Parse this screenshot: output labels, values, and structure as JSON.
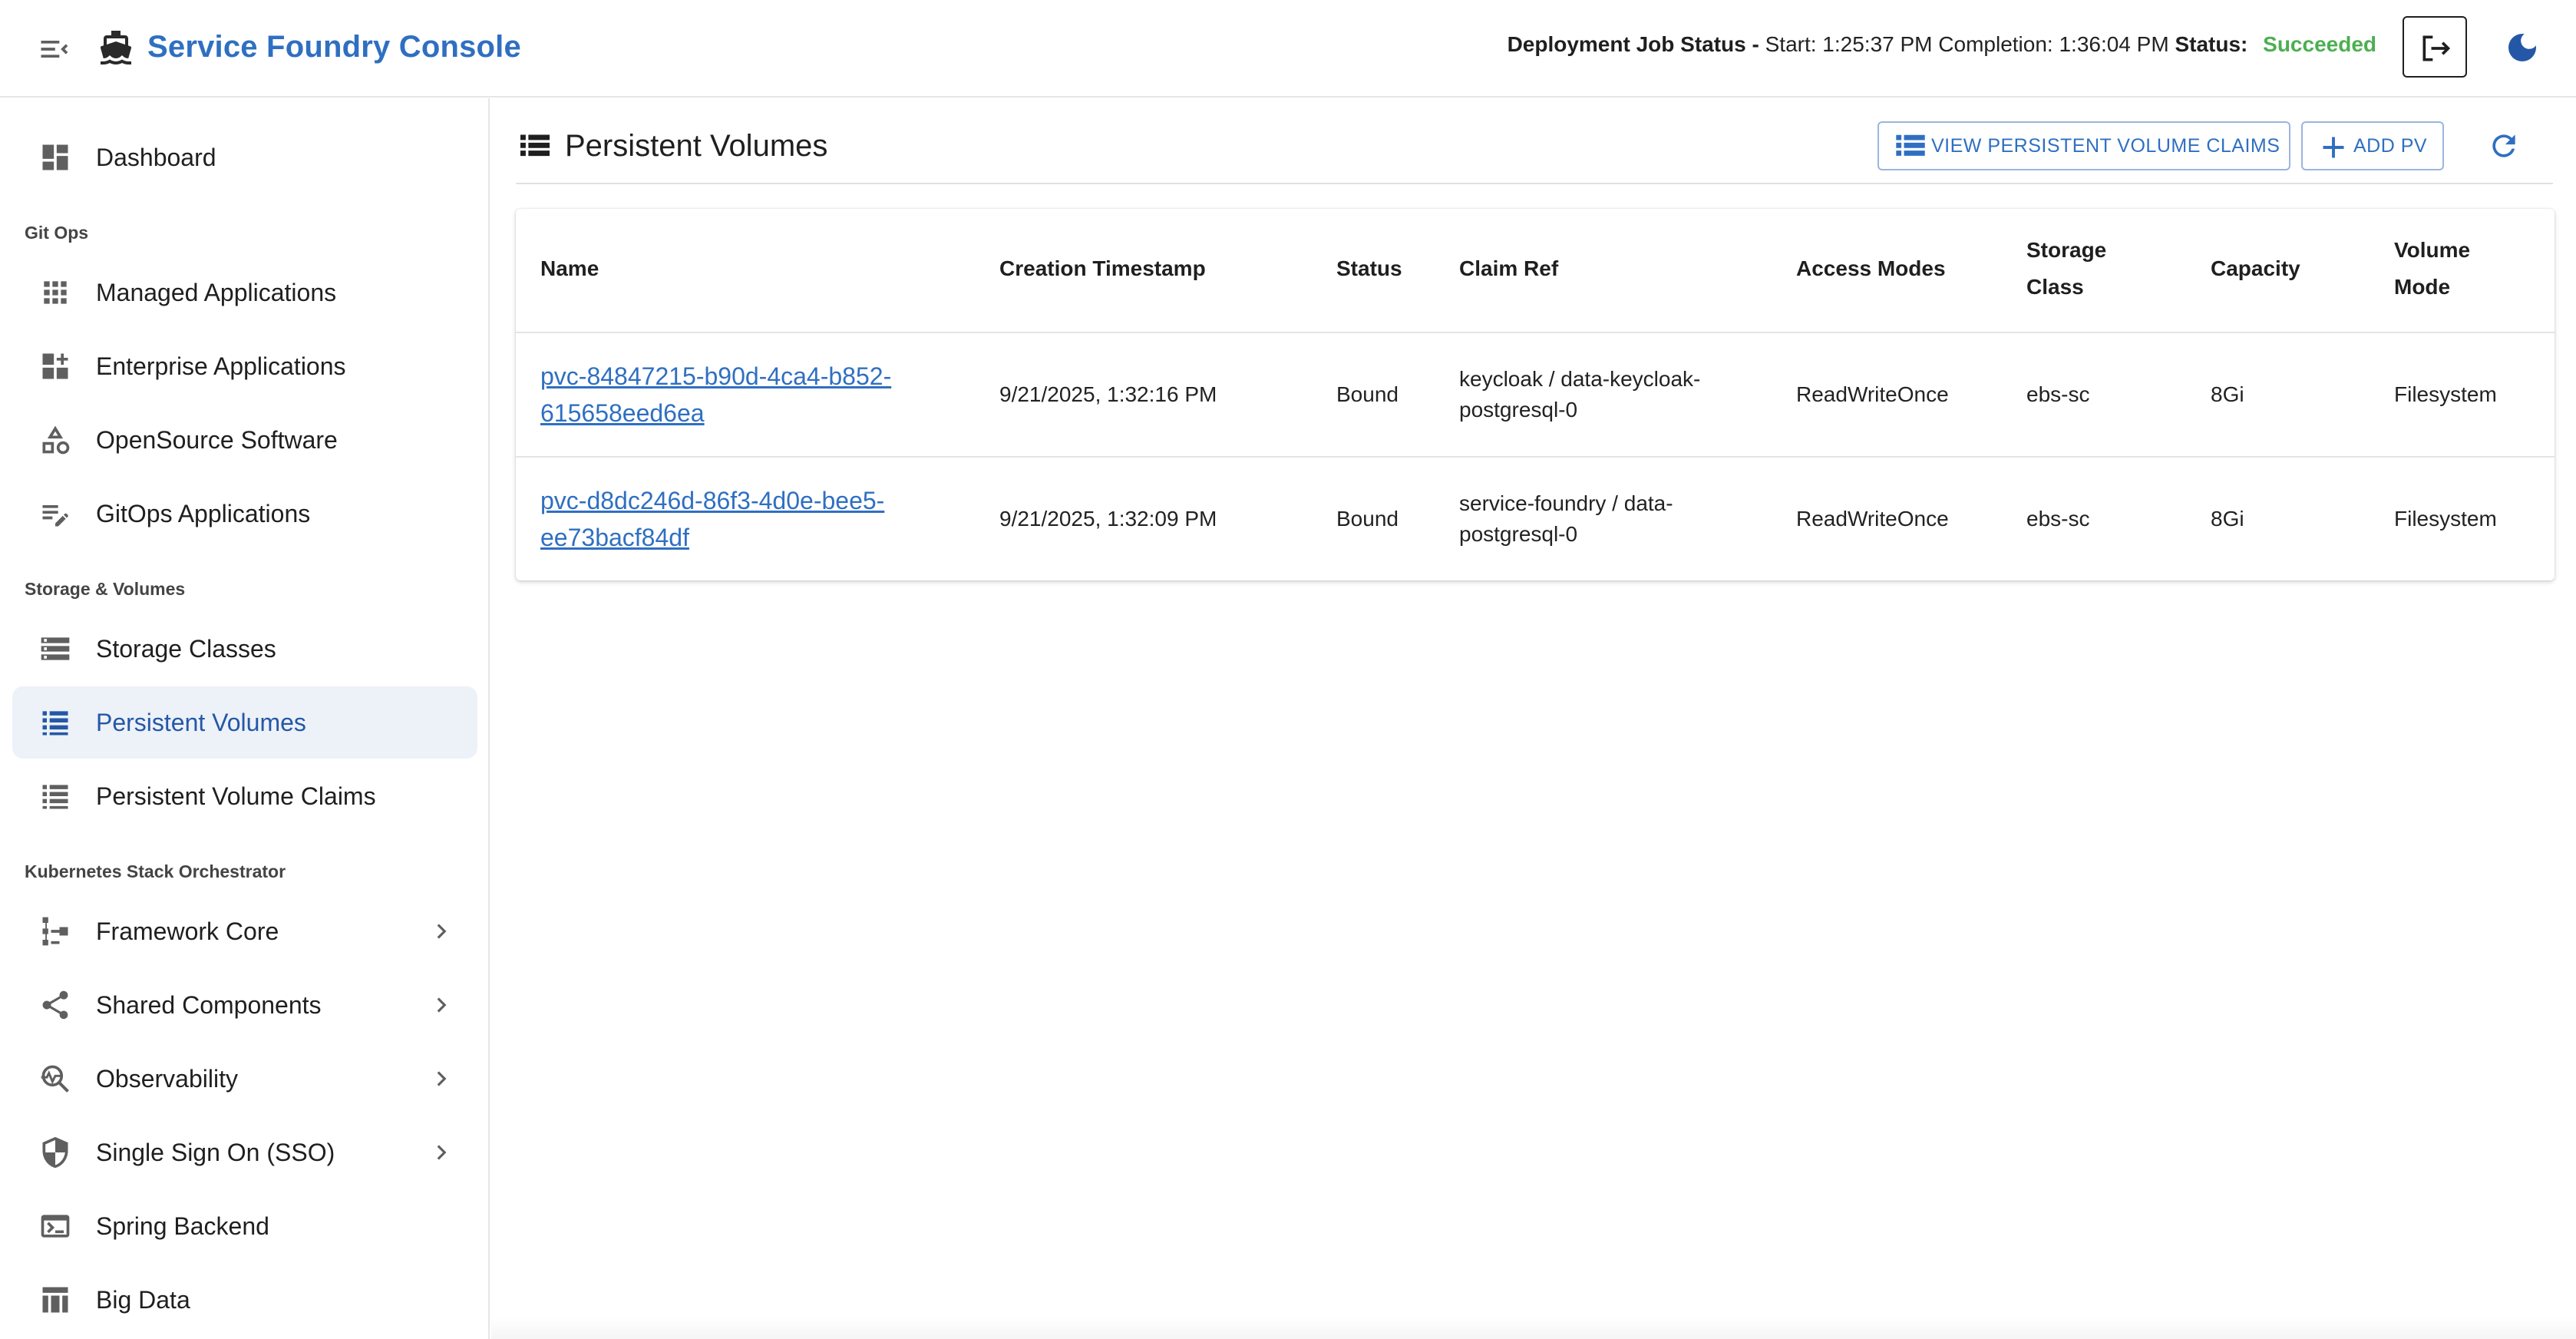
{
  "header": {
    "brand": "Service Foundry Console",
    "job_status_label": "Deployment Job Status -",
    "job_status_times": "Start: 1:25:37 PM Completion: 1:36:04 PM",
    "job_status_status_label": "Status:",
    "job_status_value": "Succeeded"
  },
  "sidebar": {
    "dashboard": "Dashboard",
    "sections": {
      "gitops": "Git Ops",
      "storage": "Storage & Volumes",
      "kso": "Kubernetes Stack Orchestrator"
    },
    "items": {
      "managed_apps": "Managed Applications",
      "enterprise_apps": "Enterprise Applications",
      "opensource": "OpenSource Software",
      "gitops_apps": "GitOps Applications",
      "storage_classes": "Storage Classes",
      "persistent_volumes": "Persistent Volumes",
      "pvcs": "Persistent Volume Claims",
      "framework_core": "Framework Core",
      "shared_components": "Shared Components",
      "observability": "Observability",
      "sso": "Single Sign On (SSO)",
      "spring_backend": "Spring Backend",
      "big_data": "Big Data"
    }
  },
  "main": {
    "title": "Persistent Volumes",
    "view_claims_label": "VIEW PERSISTENT VOLUME CLAIMS",
    "add_pv_label": "ADD PV",
    "table": {
      "headers": {
        "name": "Name",
        "created": "Creation Timestamp",
        "status": "Status",
        "claim": "Claim Ref",
        "access": "Access Modes",
        "storage_class_1": "Storage",
        "storage_class_2": "Class",
        "capacity": "Capacity",
        "volume_mode_1": "Volume",
        "volume_mode_2": "Mode"
      },
      "rows": [
        {
          "name_1": "pvc-84847215-b90d-4ca4-b852-",
          "name_2": "615658eed6ea",
          "created": "9/21/2025, 1:32:16 PM",
          "status": "Bound",
          "claim_1": "keycloak / data-keycloak-",
          "claim_2": "postgresql-0",
          "access": "ReadWriteOnce",
          "storage_class": "ebs-sc",
          "capacity": "8Gi",
          "volume_mode": "Filesystem"
        },
        {
          "name_1": "pvc-d8dc246d-86f3-4d0e-bee5-",
          "name_2": "ee73bacf84df",
          "created": "9/21/2025, 1:32:09 PM",
          "status": "Bound",
          "claim_1": "service-foundry / data-",
          "claim_2": "postgresql-0",
          "access": "ReadWriteOnce",
          "storage_class": "ebs-sc",
          "capacity": "8Gi",
          "volume_mode": "Filesystem"
        }
      ]
    }
  },
  "colors": {
    "brand": "#2f6fc1",
    "success": "#4caf50",
    "active_bg": "#edf1f8",
    "active_text": "#2458a6"
  }
}
